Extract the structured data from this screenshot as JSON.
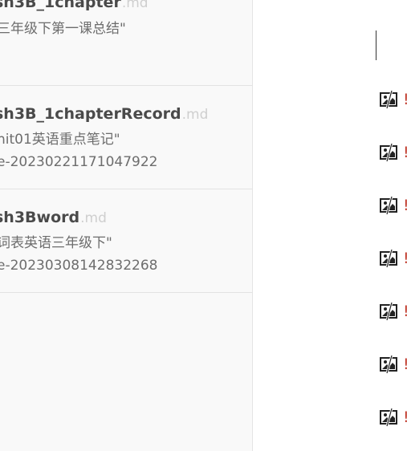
{
  "sidebar": {
    "files": [
      {
        "name": "sh3B_1chapter",
        "ext": ".md",
        "lines": [
          "三年级下第一课总结\""
        ]
      },
      {
        "name": "sh3B_1chapterRecord",
        "ext": ".md",
        "lines": [
          "nit01英语重点笔记\"",
          "e-20230221171047922"
        ]
      },
      {
        "name": "sh3Bword",
        "ext": ".md",
        "lines": [
          "词表英语三年级下\"",
          "e-20230308142832268"
        ]
      }
    ]
  },
  "editor": {
    "images": [
      {
        "icon": "broken-image-icon",
        "alt": "!"
      },
      {
        "icon": "broken-image-icon",
        "alt": "!"
      },
      {
        "icon": "broken-image-icon",
        "alt": "!"
      },
      {
        "icon": "broken-image-icon",
        "alt": "!"
      },
      {
        "icon": "broken-image-icon",
        "alt": "!"
      },
      {
        "icon": "broken-image-icon",
        "alt": "!"
      },
      {
        "icon": "broken-image-icon",
        "alt": "!"
      }
    ]
  }
}
